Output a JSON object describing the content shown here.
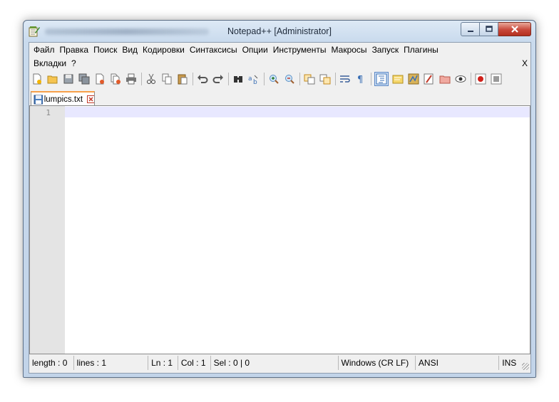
{
  "window": {
    "title": "Notepad++ [Administrator]",
    "close_icon": "close-icon",
    "minimize_icon": "minimize-icon",
    "maximize_icon": "maximize-icon"
  },
  "menu": {
    "items": [
      "Файл",
      "Правка",
      "Поиск",
      "Вид",
      "Кодировки",
      "Синтаксисы",
      "Опции",
      "Инструменты",
      "Макросы",
      "Запуск",
      "Плагины"
    ],
    "items_row2": [
      "Вкладки",
      "?"
    ],
    "close_document": "X"
  },
  "toolbar": {
    "icons": [
      "new-file-icon",
      "open-file-icon",
      "save-icon",
      "save-all-icon",
      "close-icon",
      "close-all-icon",
      "print-icon",
      "cut-icon",
      "copy-icon",
      "paste-icon",
      "undo-icon",
      "redo-icon",
      "find-icon",
      "replace-icon",
      "zoom-in-icon",
      "zoom-out-icon",
      "sync-vertical-icon",
      "sync-horizontal-icon",
      "word-wrap-icon",
      "show-all-chars-icon",
      "indent-guide-icon",
      "user-language-icon",
      "doc-map-icon",
      "function-list-icon",
      "folder-workspace-icon",
      "monitoring-icon",
      "record-macro-icon",
      "stop-macro-icon"
    ]
  },
  "tab": {
    "label": "lumpics.txt"
  },
  "editor": {
    "line_number": "1"
  },
  "status": {
    "length": "length : 0",
    "lines": "lines : 1",
    "ln": "Ln : 1",
    "col": "Col : 1",
    "sel": "Sel : 0 | 0",
    "eol": "Windows (CR LF)",
    "encoding": "ANSI",
    "mode": "INS"
  },
  "colors": {
    "tab_accent": "#f7a04a",
    "current_line": "#e8e8ff",
    "close_button": "#c8473a"
  }
}
